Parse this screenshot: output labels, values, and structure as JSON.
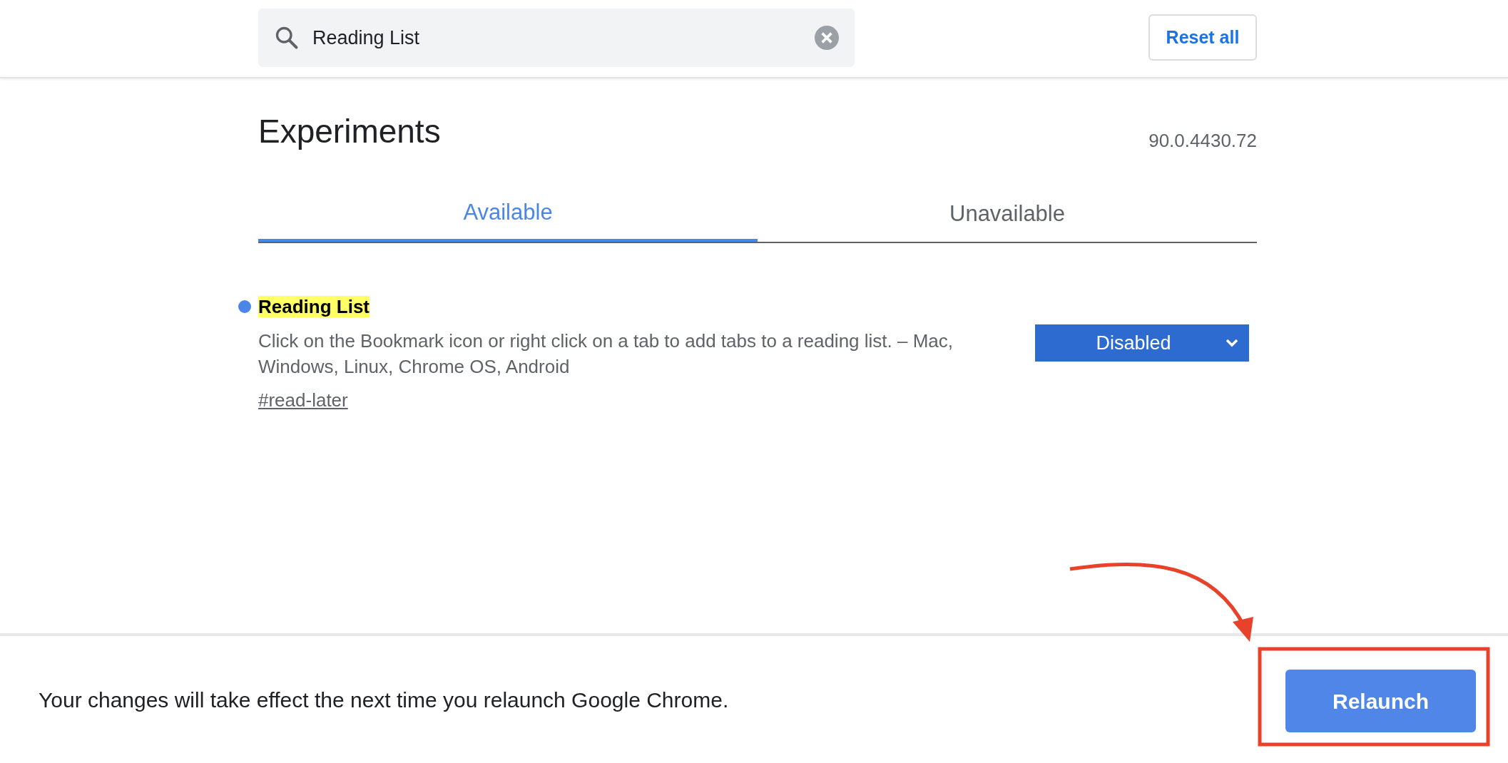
{
  "search": {
    "value": "Reading List"
  },
  "reset_button": "Reset all",
  "title": "Experiments",
  "version": "90.0.4430.72",
  "tabs": [
    {
      "label": "Available",
      "selected": true
    },
    {
      "label": "Unavailable",
      "selected": false
    }
  ],
  "flags": [
    {
      "title": "Reading List",
      "modified": true,
      "description": "Click on the Bookmark icon or right click on a tab to add tabs to a reading list. – Mac, Windows, Linux, Chrome OS, Android",
      "link": "#read-later",
      "value": "Disabled"
    }
  ],
  "footer": {
    "message": "Your changes will take effect the next time you relaunch Google Chrome.",
    "button": "Relaunch"
  }
}
